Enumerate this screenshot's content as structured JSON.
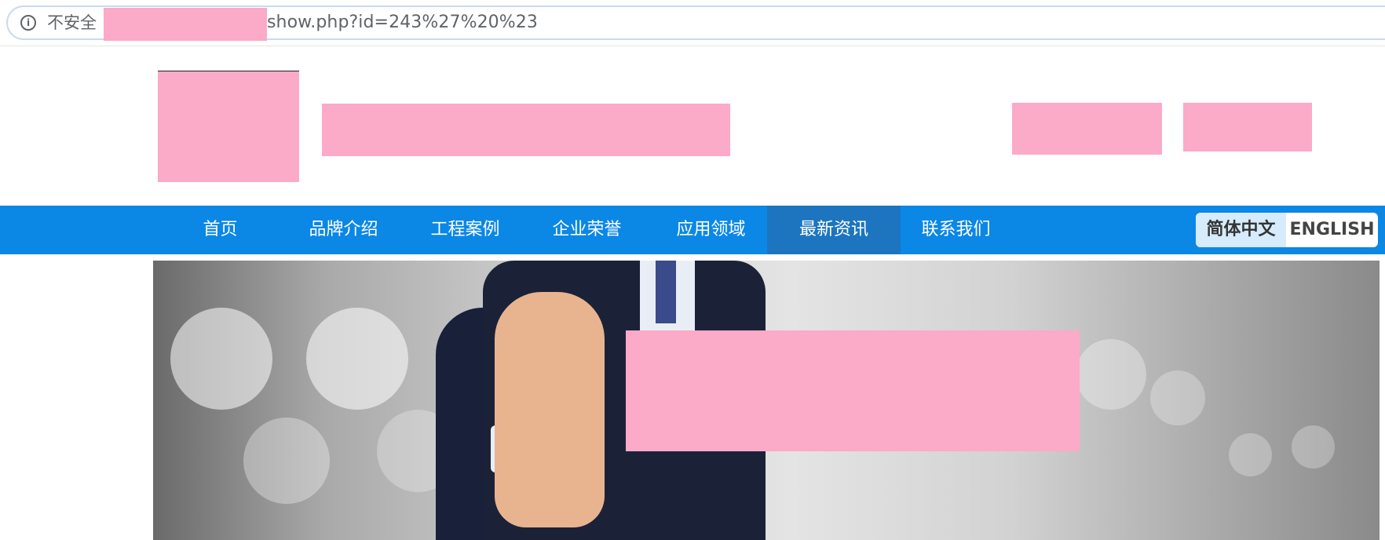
{
  "address_bar": {
    "security_label": "不安全",
    "url_suffix": "show.php?id=243%27%20%23"
  },
  "nav": {
    "items": [
      {
        "label": "首页"
      },
      {
        "label": "品牌介绍"
      },
      {
        "label": "工程案例"
      },
      {
        "label": "企业荣誉"
      },
      {
        "label": "应用领域"
      },
      {
        "label": "最新资讯",
        "active": true
      },
      {
        "label": "联系我们"
      }
    ]
  },
  "language": {
    "chinese": "简体中文",
    "english": "ENGLISH"
  },
  "colors": {
    "nav_bg": "#0b87e6",
    "nav_active_bg": "#1d75c0",
    "redaction": "#fbaac7"
  }
}
